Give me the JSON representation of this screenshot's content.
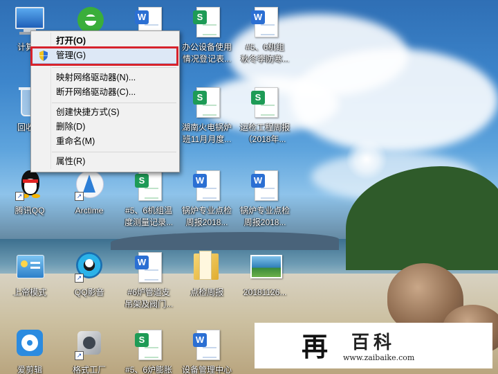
{
  "desktop": {
    "icons": [
      {
        "id": "computer",
        "label": "计算机",
        "type": "computer"
      },
      {
        "id": "browser",
        "label": "",
        "type": "browser"
      },
      {
        "id": "doc-1",
        "label": "",
        "type": "word"
      },
      {
        "id": "doc-office",
        "label": "办公设备使用\n情况登记表...",
        "type": "excel"
      },
      {
        "id": "doc-5-6",
        "label": "#5、6机组\n秋冬季防寒...",
        "type": "word"
      },
      {
        "id": "recycle",
        "label": "回收站",
        "type": "recycle"
      },
      {
        "id": "doc-hunan",
        "label": "湖南火电锅炉\n班11月月度...",
        "type": "excel"
      },
      {
        "id": "doc-yunjian",
        "label": "运检工程周报\n（2018年...",
        "type": "excel"
      },
      {
        "id": "qq",
        "label": "腾讯QQ",
        "type": "qq"
      },
      {
        "id": "arctime",
        "label": "Arctime",
        "type": "arctime"
      },
      {
        "id": "doc-temp",
        "label": "#5、6机组温\n度测量记录...",
        "type": "excel"
      },
      {
        "id": "doc-boiler-1",
        "label": "锅炉专业点检\n周报2018...",
        "type": "word"
      },
      {
        "id": "doc-boiler-2",
        "label": "锅炉专业点检\n周报2018...",
        "type": "word"
      },
      {
        "id": "shangdi",
        "label": "上帝模式",
        "type": "godmode"
      },
      {
        "id": "qqplayer",
        "label": "QQ影音",
        "type": "qqplayer"
      },
      {
        "id": "doc-6-pipe",
        "label": "#6炉管道支\n吊架及阀门...",
        "type": "word"
      },
      {
        "id": "folder-check",
        "label": "点检周报",
        "type": "folder"
      },
      {
        "id": "img-20181126",
        "label": "20181126...",
        "type": "image"
      },
      {
        "id": "editor",
        "label": "爱剪辑",
        "type": "editor"
      },
      {
        "id": "format-factory",
        "label": "格式工厂",
        "type": "factory"
      },
      {
        "id": "doc-6-boiler",
        "label": "#5、6炉膨胀",
        "type": "excel"
      },
      {
        "id": "doc-equip",
        "label": "设备管理中心",
        "type": "word"
      }
    ]
  },
  "context_menu": {
    "items": [
      {
        "label": "打开(O)",
        "bold": true
      },
      {
        "label": "管理(G)",
        "bold": false,
        "highlighted": true
      },
      {
        "label": "映射网络驱动器(N)...",
        "bold": false
      },
      {
        "label": "断开网络驱动器(C)...",
        "bold": false
      },
      {
        "label": "创建快捷方式(S)",
        "bold": false
      },
      {
        "label": "删除(D)",
        "bold": false
      },
      {
        "label": "重命名(M)",
        "bold": false
      },
      {
        "label": "属性(R)",
        "bold": false
      }
    ]
  },
  "watermark": {
    "logo_char": "再",
    "name": "百科",
    "url": "www.zaibaike.com"
  },
  "colors": {
    "highlight_box": "#d7222b",
    "word_blue": "#2b6fd3",
    "excel_green": "#1e9b56"
  }
}
